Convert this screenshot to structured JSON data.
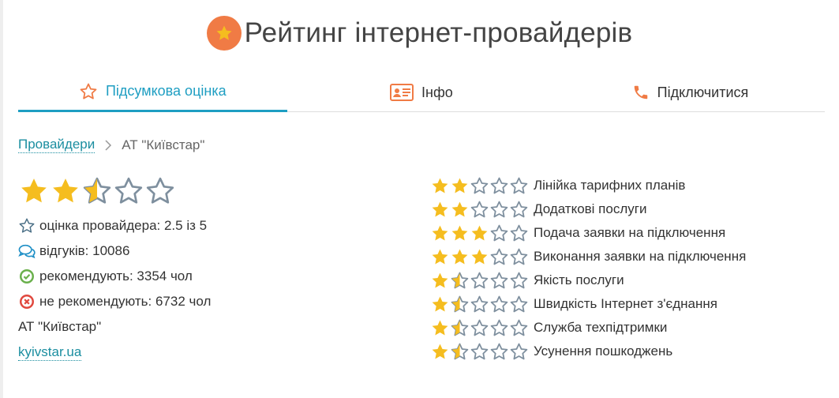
{
  "header": {
    "title": "Рейтинг інтернет-провайдерів",
    "logo_icon": "star-icon"
  },
  "tabs": [
    {
      "label": "Підсумкова оцінка",
      "icon": "star-outline-icon",
      "active": true
    },
    {
      "label": "Інфо",
      "icon": "id-card-icon",
      "active": false
    },
    {
      "label": "Підключитися",
      "icon": "phone-icon",
      "active": false
    }
  ],
  "breadcrumb": {
    "root": "Провайдери",
    "current": "АТ \"Київстар\""
  },
  "provider": {
    "rating": 2.5,
    "rating_max": 5,
    "rating_text": "оцінка провайдера: 2.5 із 5",
    "reviews_text": "відгуків: 10086",
    "recommend_text": "рекомендують: 3354 чол",
    "not_recommend_text": "не рекомендують: 6732 чол",
    "name": "АТ \"Київстар\"",
    "site": "kyivstar.ua"
  },
  "criteria": [
    {
      "label": "Лінійка тарифних планів",
      "rating": 2
    },
    {
      "label": "Додаткові послуги",
      "rating": 2
    },
    {
      "label": "Подача заявки на підключення",
      "rating": 3
    },
    {
      "label": "Виконання заявки на підключення",
      "rating": 3
    },
    {
      "label": "Якість послуги",
      "rating": 1.5
    },
    {
      "label": "Швидкість Інтернет з'єднання",
      "rating": 1.5
    },
    {
      "label": "Служба техпідтримки",
      "rating": 1.5
    },
    {
      "label": "Усунення пошкоджень",
      "rating": 1.5
    }
  ],
  "colors": {
    "accent": "#1e9ec2",
    "link": "#1b8ea0",
    "star_fill": "#f5bd1f",
    "star_outline": "#7e8f9e",
    "logo": "#f07b45",
    "tab_icon": "#f07b45",
    "ok_green": "#6ab04c",
    "no_red": "#e0483e"
  }
}
